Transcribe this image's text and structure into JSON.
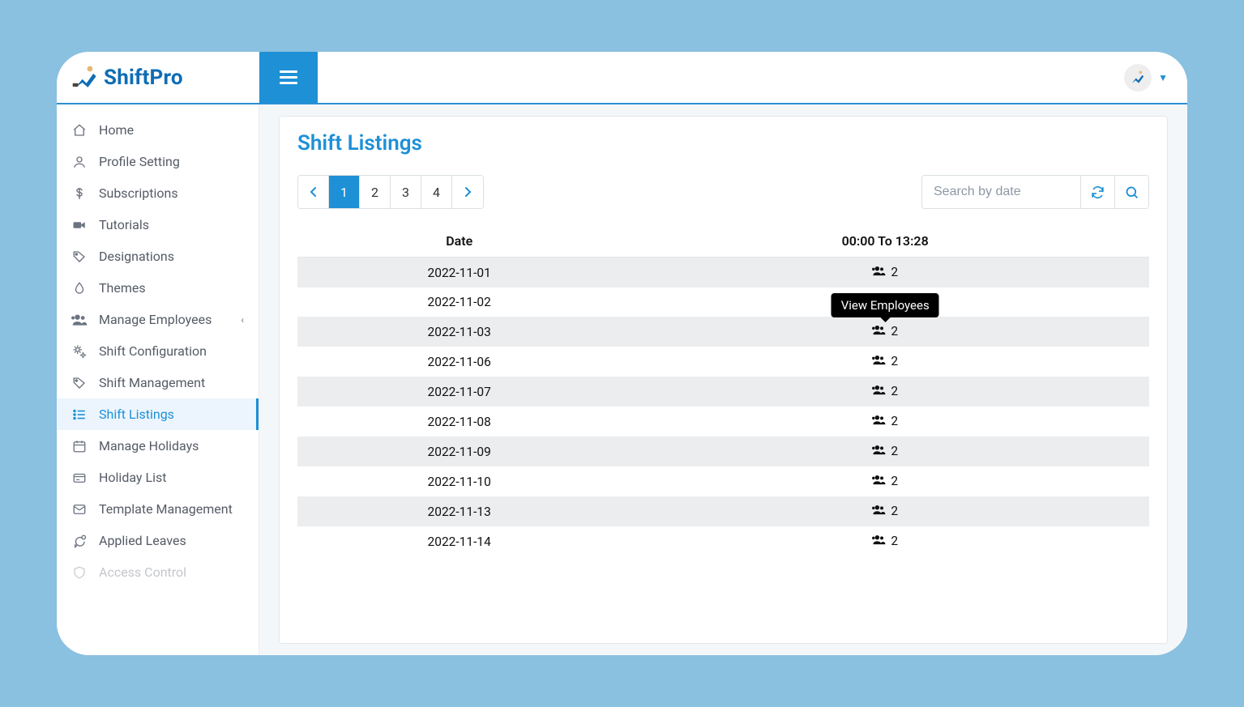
{
  "brand": {
    "name": "ShiftPro"
  },
  "sidebar": {
    "items": [
      {
        "label": "Home",
        "icon": "home"
      },
      {
        "label": "Profile Setting",
        "icon": "user"
      },
      {
        "label": "Subscriptions",
        "icon": "dollar"
      },
      {
        "label": "Tutorials",
        "icon": "video"
      },
      {
        "label": "Designations",
        "icon": "tag"
      },
      {
        "label": "Themes",
        "icon": "drop"
      },
      {
        "label": "Manage Employees",
        "icon": "users",
        "chevron": true
      },
      {
        "label": "Shift Configuration",
        "icon": "cogs"
      },
      {
        "label": "Shift Management",
        "icon": "tag"
      },
      {
        "label": "Shift Listings",
        "icon": "list",
        "active": true
      },
      {
        "label": "Manage Holidays",
        "icon": "calendar"
      },
      {
        "label": "Holiday List",
        "icon": "card"
      },
      {
        "label": "Template Management",
        "icon": "mail"
      },
      {
        "label": "Applied Leaves",
        "icon": "chat"
      },
      {
        "label": "Access Control",
        "icon": "shield",
        "faded": true
      }
    ]
  },
  "page": {
    "title": "Shift Listings",
    "pagination": {
      "pages": [
        "1",
        "2",
        "3",
        "4"
      ],
      "current": "1"
    },
    "search_placeholder": "Search by date",
    "table": {
      "headers": {
        "date": "Date",
        "shift": "00:00 To 13:28"
      },
      "rows": [
        {
          "date": "2022-11-01",
          "count": "2"
        },
        {
          "date": "2022-11-02",
          "count": ""
        },
        {
          "date": "2022-11-03",
          "count": "2",
          "tooltip": true
        },
        {
          "date": "2022-11-06",
          "count": "2"
        },
        {
          "date": "2022-11-07",
          "count": "2"
        },
        {
          "date": "2022-11-08",
          "count": "2"
        },
        {
          "date": "2022-11-09",
          "count": "2"
        },
        {
          "date": "2022-11-10",
          "count": "2"
        },
        {
          "date": "2022-11-13",
          "count": "2"
        },
        {
          "date": "2022-11-14",
          "count": "2"
        }
      ]
    },
    "tooltip_text": "View Employees"
  }
}
